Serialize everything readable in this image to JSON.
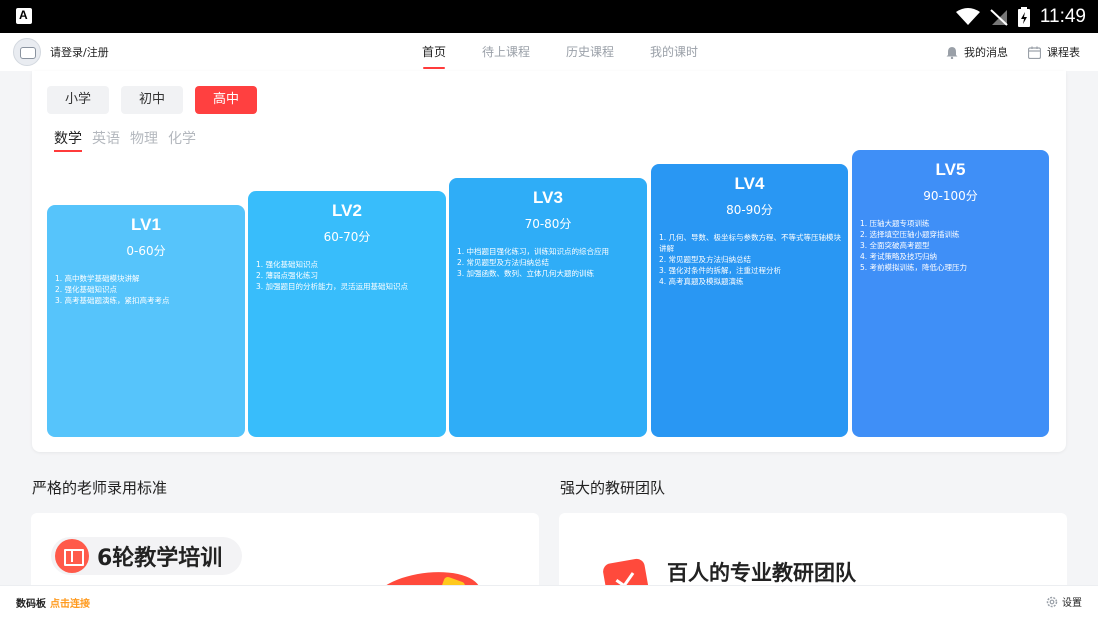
{
  "status_bar": {
    "time": "11:49"
  },
  "header": {
    "login_text": "请登录/注册",
    "tabs": [
      {
        "label": "首页",
        "active": true
      },
      {
        "label": "待上课程",
        "active": false
      },
      {
        "label": "历史课程",
        "active": false
      },
      {
        "label": "我的课时",
        "active": false
      }
    ],
    "messages_label": "我的消息",
    "schedule_label": "课程表"
  },
  "grades": [
    {
      "label": "小学",
      "active": false
    },
    {
      "label": "初中",
      "active": false
    },
    {
      "label": "高中",
      "active": true
    }
  ],
  "subjects": [
    {
      "label": "数学",
      "active": true
    },
    {
      "label": "英语",
      "active": false
    },
    {
      "label": "物理",
      "active": false
    },
    {
      "label": "化学",
      "active": false
    }
  ],
  "levels": [
    {
      "title": "LV1",
      "range": "0-60分",
      "color": "#56c4fb",
      "items": [
        "1. 高中数学基础模块讲解",
        "2. 强化基础知识点",
        "3. 高考基础题演练，紧扣高考考点"
      ]
    },
    {
      "title": "LV2",
      "range": "60-70分",
      "color": "#38bdfb",
      "items": [
        "1. 强化基础知识点",
        "2. 薄弱点强化练习",
        "3. 加强题目的分析能力，灵活运用基础知识点"
      ]
    },
    {
      "title": "LV3",
      "range": "70-80分",
      "color": "#2fadf7",
      "items": [
        "1. 中档题目强化练习，训练知识点的综合应用",
        "2. 常见题型及方法归纳总结",
        "3. 加强函数、数列、立体几何大题的训练"
      ]
    },
    {
      "title": "LV4",
      "range": "80-90分",
      "color": "#2997f3",
      "items": [
        "1. 几何、导数、极坐标与参数方程、不等式等压轴模块讲解",
        "2. 常见题型及方法归纳总结",
        "3. 强化对条件的拆解，注重过程分析",
        "4. 高考真题及模拟题演练"
      ]
    },
    {
      "title": "LV5",
      "range": "90-100分",
      "color": "#3f8ff7",
      "items": [
        "1. 压轴大题专项训练",
        "2. 选择填空压轴小题穿插训练",
        "3. 全面突破高考题型",
        "4. 考试策略及技巧归纳",
        "5. 考前模拟训练，降低心理压力"
      ]
    }
  ],
  "sections": {
    "left_title": "严格的老师录用标准",
    "right_title": "强大的教研团队",
    "left_pill": "6轮教学培训",
    "right_heading": "百人的专业教研团队"
  },
  "bottom_bar": {
    "board_label": "数码板",
    "connect_link": "点击连接",
    "settings_label": "设置"
  }
}
